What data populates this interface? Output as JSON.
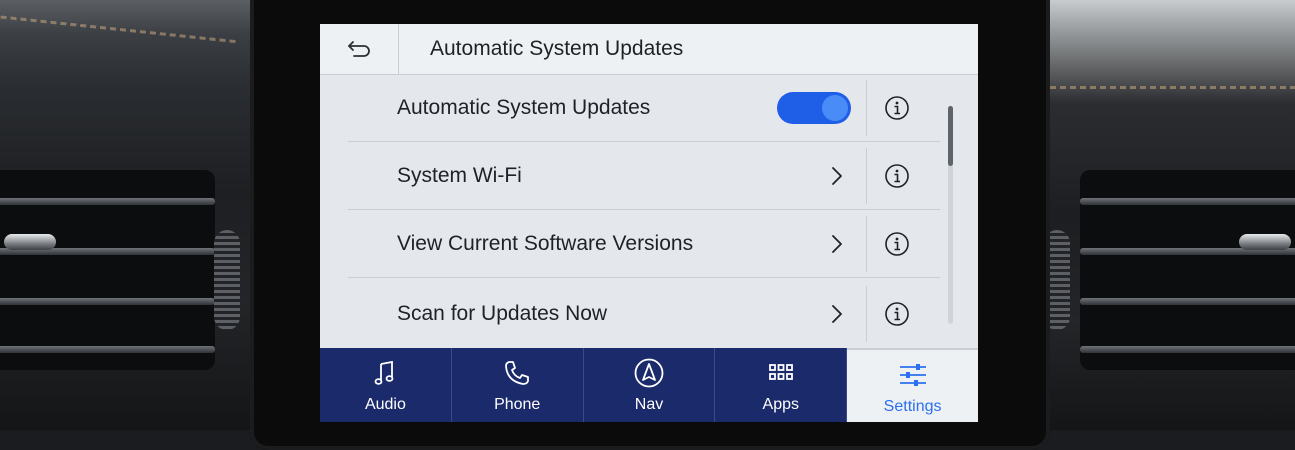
{
  "header": {
    "title": "Automatic System Updates"
  },
  "rows": [
    {
      "label": "Automatic System Updates",
      "control": "toggle",
      "toggle_on": true
    },
    {
      "label": "System Wi-Fi",
      "control": "chevron"
    },
    {
      "label": "View Current Software Versions",
      "control": "chevron"
    },
    {
      "label": "Scan for Updates Now",
      "control": "chevron"
    }
  ],
  "nav": {
    "items": [
      {
        "label": "Audio",
        "icon": "music-note-icon"
      },
      {
        "label": "Phone",
        "icon": "phone-icon"
      },
      {
        "label": "Nav",
        "icon": "navigation-icon"
      },
      {
        "label": "Apps",
        "icon": "apps-grid-icon"
      },
      {
        "label": "Settings",
        "icon": "settings-sliders-icon",
        "active": true
      }
    ]
  },
  "colors": {
    "nav_background": "#1a2a6b",
    "accent": "#2c6ff0",
    "toggle_on": "#1f5fe8",
    "screen_background": "#e4e8ec"
  }
}
